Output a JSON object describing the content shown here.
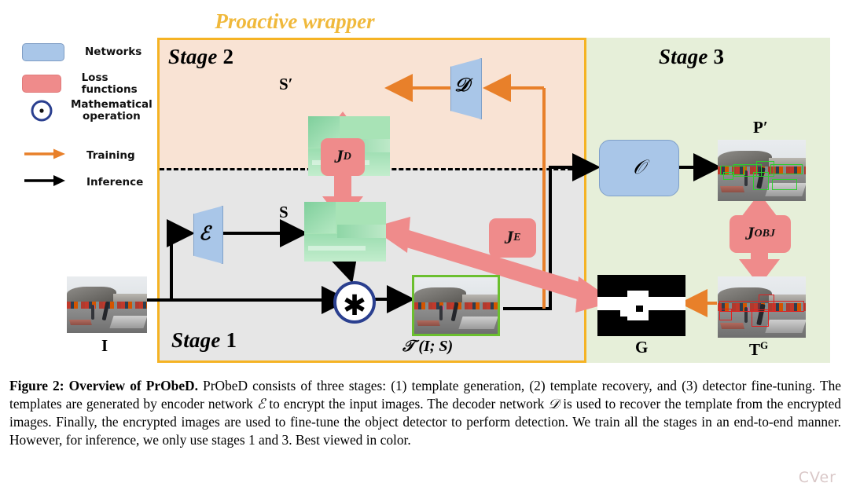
{
  "figure": {
    "banner": "Proactive wrapper",
    "banner_color": "#f0b93c",
    "stages": [
      {
        "name": "stage-1",
        "label_word": "Stage",
        "label_num": "1",
        "fill": "#e6e6e6"
      },
      {
        "name": "stage-2",
        "label_word": "Stage",
        "label_num": "2",
        "fill": "#f9e3d4",
        "border": "#f5b324"
      },
      {
        "name": "stage-3",
        "label_word": "Stage",
        "label_num": "3",
        "fill": "#e6efd9"
      }
    ],
    "legend": {
      "items": [
        {
          "icon": "blue-rounded-rect",
          "label": "Networks",
          "color": "#a9c6e8"
        },
        {
          "icon": "red-rounded-rect",
          "label": "Loss functions",
          "color": "#ef8b8b"
        },
        {
          "icon": "circle-dot-operation",
          "label": "Mathematical operation",
          "label_line1": "Mathematical",
          "label_line2": "operation",
          "color": "#2a3f8f"
        },
        {
          "icon": "orange-arrow",
          "label": "Training",
          "color": "#e8802a"
        },
        {
          "icon": "black-arrow",
          "label": "Inference",
          "color": "#000000"
        }
      ]
    },
    "nodes": {
      "input_image": "I",
      "encoder": "ℰ",
      "decoder": "𝒟",
      "detector": "𝒪",
      "template": "S",
      "template_recovered": "S′",
      "encrypted_image": "𝒯 (I; S)",
      "encrypted_image_plain": "T(I; S)",
      "prediction": "P′",
      "ground_truth_mask": "G",
      "detection_target": "T",
      "detection_target_sup": "G"
    },
    "losses": [
      {
        "name": "decoder-loss",
        "label_main": "J",
        "label_sub": "D",
        "color": "#ef8b8b"
      },
      {
        "name": "encoder-loss",
        "label_main": "J",
        "label_sub": "E",
        "color": "#ef8b8b"
      },
      {
        "name": "object-loss",
        "label_main": "J",
        "label_sub": "OBJ",
        "color": "#ef8b8b"
      }
    ]
  },
  "caption": {
    "bold_lead": "Figure 2: Overview of PrObeD.",
    "body_part1": " PrObeD consists of three stages: (1) template generation, (2) template recovery, and (3) detector fine-tuning. The templates are generated by encoder network ",
    "sym_encoder": "ℰ",
    "body_part2": " to encrypt the input images. The decoder network ",
    "sym_decoder": "𝒟",
    "body_part3": " is used to recover the template from the encrypted images. Finally, the encrypted images are used to fine-tune the object detector to perform detection. We train all the stages in an end-to-end manner. However, for inference, we only use stages 1 and 3. Best viewed in color."
  },
  "watermark": "CVer"
}
